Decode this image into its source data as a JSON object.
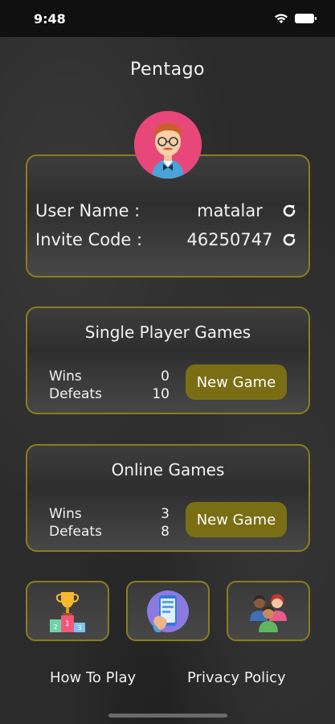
{
  "status_bar": {
    "time": "9:48"
  },
  "app": {
    "title": "Pentago"
  },
  "profile": {
    "user_name_label": "User Name :",
    "user_name_value": "matalar",
    "invite_code_label": "Invite Code :",
    "invite_code_value": "46250747"
  },
  "single_player": {
    "title": "Single Player Games",
    "wins_label": "Wins",
    "wins_value": "0",
    "defeats_label": "Defeats",
    "defeats_value": "10",
    "button_label": "New Game"
  },
  "online": {
    "title": "Online Games",
    "wins_label": "Wins",
    "wins_value": "3",
    "defeats_label": "Defeats",
    "defeats_value": "8",
    "button_label": "New Game"
  },
  "tiles": [
    "leaderboard-icon",
    "phone-app-icon",
    "friends-icon"
  ],
  "footer": {
    "how_to_play": "How To Play",
    "privacy_policy": "Privacy Policy"
  },
  "colors": {
    "accent": "#8a7d1e",
    "button": "#7a6e14",
    "avatar_bg": "#e8477a"
  }
}
